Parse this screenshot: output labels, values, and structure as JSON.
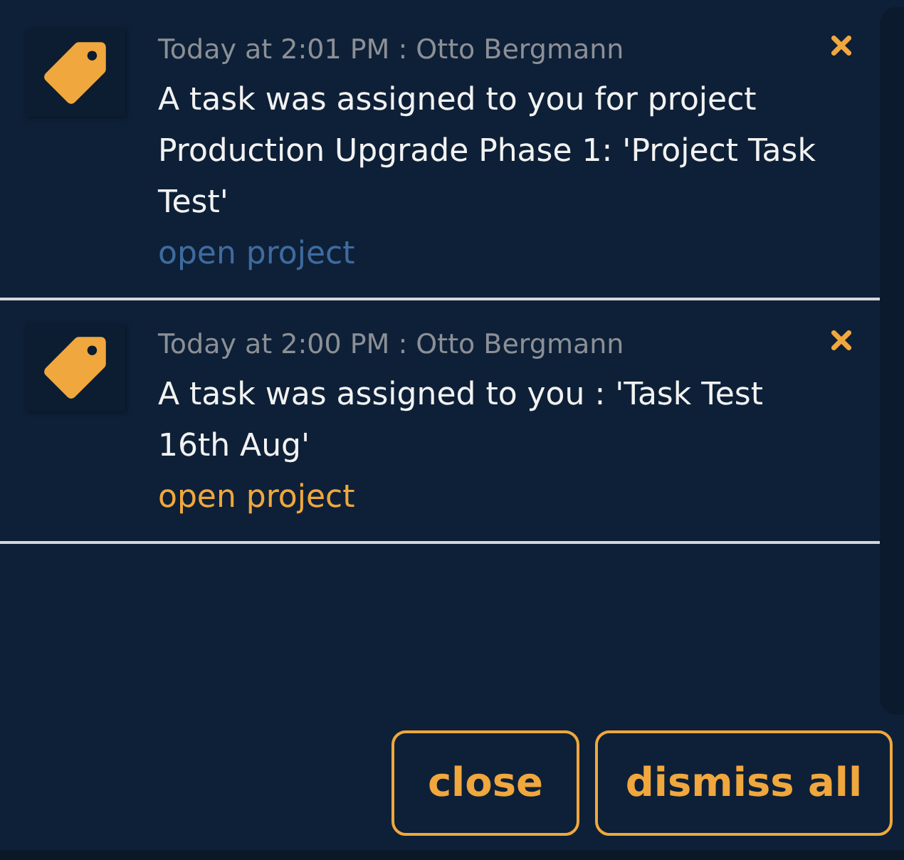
{
  "notifications": [
    {
      "timestamp": "Today at 2:01 PM : Otto Bergmann",
      "message": "A task was assigned to you for project Production Upgrade Phase 1: 'Project Task Test'",
      "link": {
        "label": "open project",
        "color": "#3e6b9f"
      }
    },
    {
      "timestamp": "Today at 2:00 PM : Otto Bergmann",
      "message": "A task was assigned to you : 'Task Test 16th Aug'",
      "link": {
        "label": "open project",
        "color": "#f0a73d"
      }
    }
  ],
  "buttons": [
    {
      "label": "close"
    },
    {
      "label": "dismiss all"
    }
  ]
}
